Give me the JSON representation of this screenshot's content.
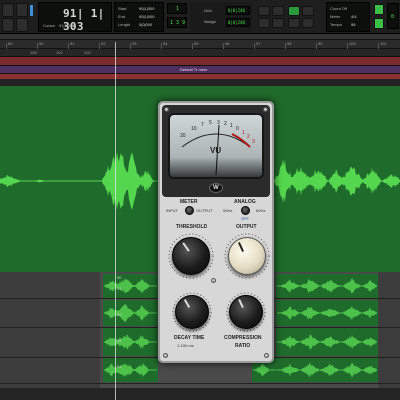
{
  "transport": {
    "counter": "91| 1| 303",
    "cursor_label": "Cursor",
    "cursor_value": "91|1|303",
    "start_label": "Start",
    "end_label": "End",
    "length_label": "Length",
    "start_value": "90|1|000",
    "end_value": "90|1|000",
    "length_value": "0|0|000",
    "nudge_label": "Nudge",
    "nudge_value": "0|0|240",
    "grid_label": "Grid",
    "grid_value": "0|0|240",
    "counter_mode_label": "Count Off",
    "meter_label": "Meter",
    "tempo_label": "Tempo",
    "meter_value": "4/4",
    "tempo_value": "98",
    "small_values": [
      "1",
      "1 3 9",
      "0"
    ]
  },
  "ruler": {
    "bar_labels": [
      "89",
      "90",
      "91",
      "92",
      "93",
      "94",
      "95",
      "96",
      "97",
      "98",
      "99",
      "100",
      "101"
    ],
    "marker_labels": [
      "100",
      "101",
      "102"
    ],
    "region_title": "Default Tr mem"
  },
  "lower_tracks": {
    "tags": [
      "90",
      "91",
      "92",
      "93",
      "94"
    ]
  },
  "plugin": {
    "meter_label": "METER",
    "input_label": "INPUT",
    "output_label": "OUTPUT",
    "analog_label": "ANALOG",
    "analog_50hz": "50Hz",
    "analog_off": "OFF",
    "analog_60hz": "60Hz",
    "threshold_label": "THRESHOLD",
    "output_knob_label": "OUTPUT",
    "decay_label": "DECAY TIME",
    "decay_sub": "1-100 ms",
    "compression_label": "COMPRESSION",
    "ratio_label": "RATIO",
    "vu_label": "VU",
    "vu_scale": [
      "20",
      "10",
      "7",
      "5",
      "3",
      "2",
      "1",
      "0",
      "1",
      "2",
      "3"
    ],
    "logo": "W"
  },
  "colors": {
    "track_green": "#1f6b2c",
    "waveform": "#54d64e",
    "lower_waveform": "#4cc24a",
    "ruler_red": "#7a2b2b",
    "ruler_purple": "#4f2f60",
    "plugin_face": "#d7d7d7",
    "cream_knob": "#e4dcc2"
  }
}
